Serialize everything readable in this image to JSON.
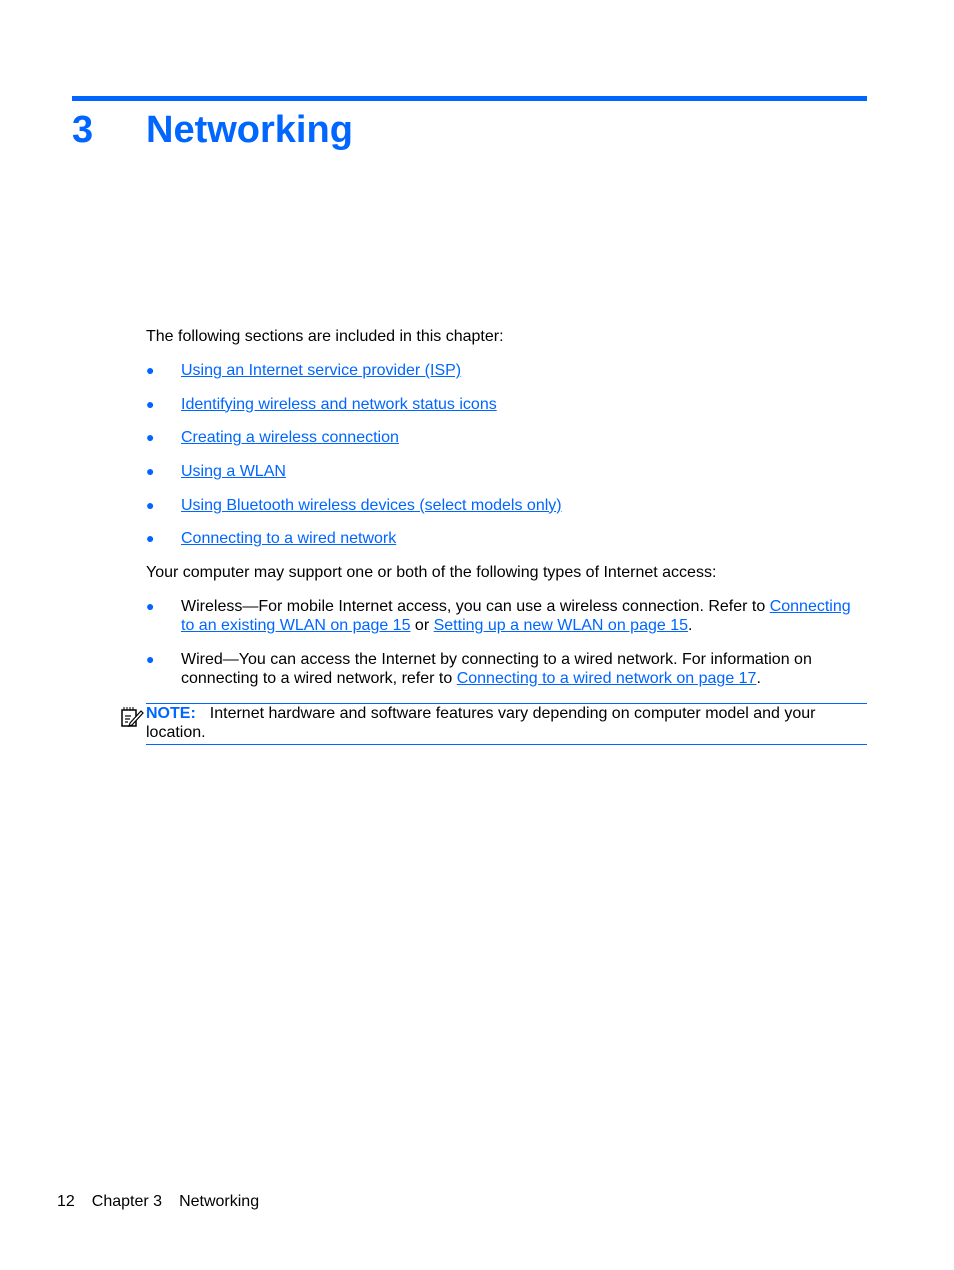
{
  "chapter": {
    "number": "3",
    "title": "Networking",
    "accent": "#0066ff"
  },
  "intro": "The following sections are included in this chapter:",
  "toc": [
    {
      "label": "Using an Internet service provider (ISP)"
    },
    {
      "label": "Identifying wireless and network status icons"
    },
    {
      "label": "Creating a wireless connection"
    },
    {
      "label": "Using a WLAN"
    },
    {
      "label": "Using Bluetooth wireless devices (select models only)"
    },
    {
      "label": "Connecting to a wired network"
    }
  ],
  "bullet_glyph": "●",
  "types_intro": "Your computer may support one or both of the following types of Internet access:",
  "access": {
    "wireless": {
      "text1": "Wireless—For mobile Internet access, you can use a wireless connection. Refer to ",
      "link1": "Connecting to an existing WLAN on page 15",
      "text2": " or ",
      "link2": "Setting up a new WLAN on page 15",
      "text3": "."
    },
    "wired": {
      "text1": "Wired—You can access the Internet by connecting to a wired network. For information on connecting to a wired network, refer to ",
      "link1": "Connecting to a wired network on page 17",
      "text2": "."
    }
  },
  "note": {
    "label": "NOTE:",
    "text": "Internet hardware and software features vary depending on computer model and your location.",
    "icon": "note-pencil-icon"
  },
  "footer": {
    "page": "12",
    "chapter": "Chapter 3",
    "title": "Networking"
  }
}
